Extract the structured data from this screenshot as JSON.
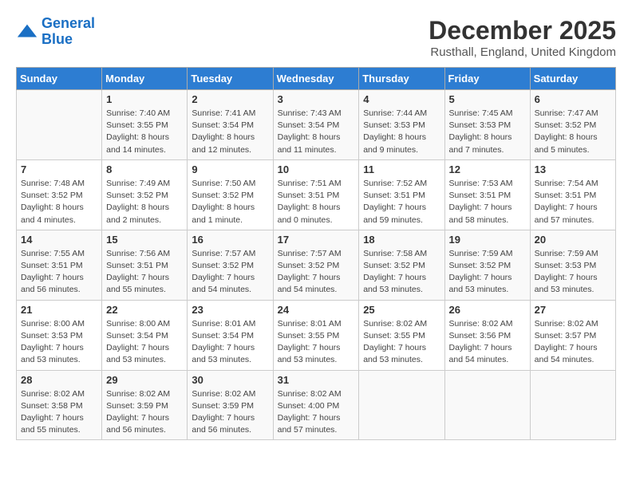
{
  "logo": {
    "line1": "General",
    "line2": "Blue",
    "icon": "▶"
  },
  "title": "December 2025",
  "subtitle": "Rusthall, England, United Kingdom",
  "days_of_week": [
    "Sunday",
    "Monday",
    "Tuesday",
    "Wednesday",
    "Thursday",
    "Friday",
    "Saturday"
  ],
  "weeks": [
    [
      {
        "day": "",
        "info": ""
      },
      {
        "day": "1",
        "info": "Sunrise: 7:40 AM\nSunset: 3:55 PM\nDaylight: 8 hours\nand 14 minutes."
      },
      {
        "day": "2",
        "info": "Sunrise: 7:41 AM\nSunset: 3:54 PM\nDaylight: 8 hours\nand 12 minutes."
      },
      {
        "day": "3",
        "info": "Sunrise: 7:43 AM\nSunset: 3:54 PM\nDaylight: 8 hours\nand 11 minutes."
      },
      {
        "day": "4",
        "info": "Sunrise: 7:44 AM\nSunset: 3:53 PM\nDaylight: 8 hours\nand 9 minutes."
      },
      {
        "day": "5",
        "info": "Sunrise: 7:45 AM\nSunset: 3:53 PM\nDaylight: 8 hours\nand 7 minutes."
      },
      {
        "day": "6",
        "info": "Sunrise: 7:47 AM\nSunset: 3:52 PM\nDaylight: 8 hours\nand 5 minutes."
      }
    ],
    [
      {
        "day": "7",
        "info": "Sunrise: 7:48 AM\nSunset: 3:52 PM\nDaylight: 8 hours\nand 4 minutes."
      },
      {
        "day": "8",
        "info": "Sunrise: 7:49 AM\nSunset: 3:52 PM\nDaylight: 8 hours\nand 2 minutes."
      },
      {
        "day": "9",
        "info": "Sunrise: 7:50 AM\nSunset: 3:52 PM\nDaylight: 8 hours\nand 1 minute."
      },
      {
        "day": "10",
        "info": "Sunrise: 7:51 AM\nSunset: 3:51 PM\nDaylight: 8 hours\nand 0 minutes."
      },
      {
        "day": "11",
        "info": "Sunrise: 7:52 AM\nSunset: 3:51 PM\nDaylight: 7 hours\nand 59 minutes."
      },
      {
        "day": "12",
        "info": "Sunrise: 7:53 AM\nSunset: 3:51 PM\nDaylight: 7 hours\nand 58 minutes."
      },
      {
        "day": "13",
        "info": "Sunrise: 7:54 AM\nSunset: 3:51 PM\nDaylight: 7 hours\nand 57 minutes."
      }
    ],
    [
      {
        "day": "14",
        "info": "Sunrise: 7:55 AM\nSunset: 3:51 PM\nDaylight: 7 hours\nand 56 minutes."
      },
      {
        "day": "15",
        "info": "Sunrise: 7:56 AM\nSunset: 3:51 PM\nDaylight: 7 hours\nand 55 minutes."
      },
      {
        "day": "16",
        "info": "Sunrise: 7:57 AM\nSunset: 3:52 PM\nDaylight: 7 hours\nand 54 minutes."
      },
      {
        "day": "17",
        "info": "Sunrise: 7:57 AM\nSunset: 3:52 PM\nDaylight: 7 hours\nand 54 minutes."
      },
      {
        "day": "18",
        "info": "Sunrise: 7:58 AM\nSunset: 3:52 PM\nDaylight: 7 hours\nand 53 minutes."
      },
      {
        "day": "19",
        "info": "Sunrise: 7:59 AM\nSunset: 3:52 PM\nDaylight: 7 hours\nand 53 minutes."
      },
      {
        "day": "20",
        "info": "Sunrise: 7:59 AM\nSunset: 3:53 PM\nDaylight: 7 hours\nand 53 minutes."
      }
    ],
    [
      {
        "day": "21",
        "info": "Sunrise: 8:00 AM\nSunset: 3:53 PM\nDaylight: 7 hours\nand 53 minutes."
      },
      {
        "day": "22",
        "info": "Sunrise: 8:00 AM\nSunset: 3:54 PM\nDaylight: 7 hours\nand 53 minutes."
      },
      {
        "day": "23",
        "info": "Sunrise: 8:01 AM\nSunset: 3:54 PM\nDaylight: 7 hours\nand 53 minutes."
      },
      {
        "day": "24",
        "info": "Sunrise: 8:01 AM\nSunset: 3:55 PM\nDaylight: 7 hours\nand 53 minutes."
      },
      {
        "day": "25",
        "info": "Sunrise: 8:02 AM\nSunset: 3:55 PM\nDaylight: 7 hours\nand 53 minutes."
      },
      {
        "day": "26",
        "info": "Sunrise: 8:02 AM\nSunset: 3:56 PM\nDaylight: 7 hours\nand 54 minutes."
      },
      {
        "day": "27",
        "info": "Sunrise: 8:02 AM\nSunset: 3:57 PM\nDaylight: 7 hours\nand 54 minutes."
      }
    ],
    [
      {
        "day": "28",
        "info": "Sunrise: 8:02 AM\nSunset: 3:58 PM\nDaylight: 7 hours\nand 55 minutes."
      },
      {
        "day": "29",
        "info": "Sunrise: 8:02 AM\nSunset: 3:59 PM\nDaylight: 7 hours\nand 56 minutes."
      },
      {
        "day": "30",
        "info": "Sunrise: 8:02 AM\nSunset: 3:59 PM\nDaylight: 7 hours\nand 56 minutes."
      },
      {
        "day": "31",
        "info": "Sunrise: 8:02 AM\nSunset: 4:00 PM\nDaylight: 7 hours\nand 57 minutes."
      },
      {
        "day": "",
        "info": ""
      },
      {
        "day": "",
        "info": ""
      },
      {
        "day": "",
        "info": ""
      }
    ]
  ]
}
